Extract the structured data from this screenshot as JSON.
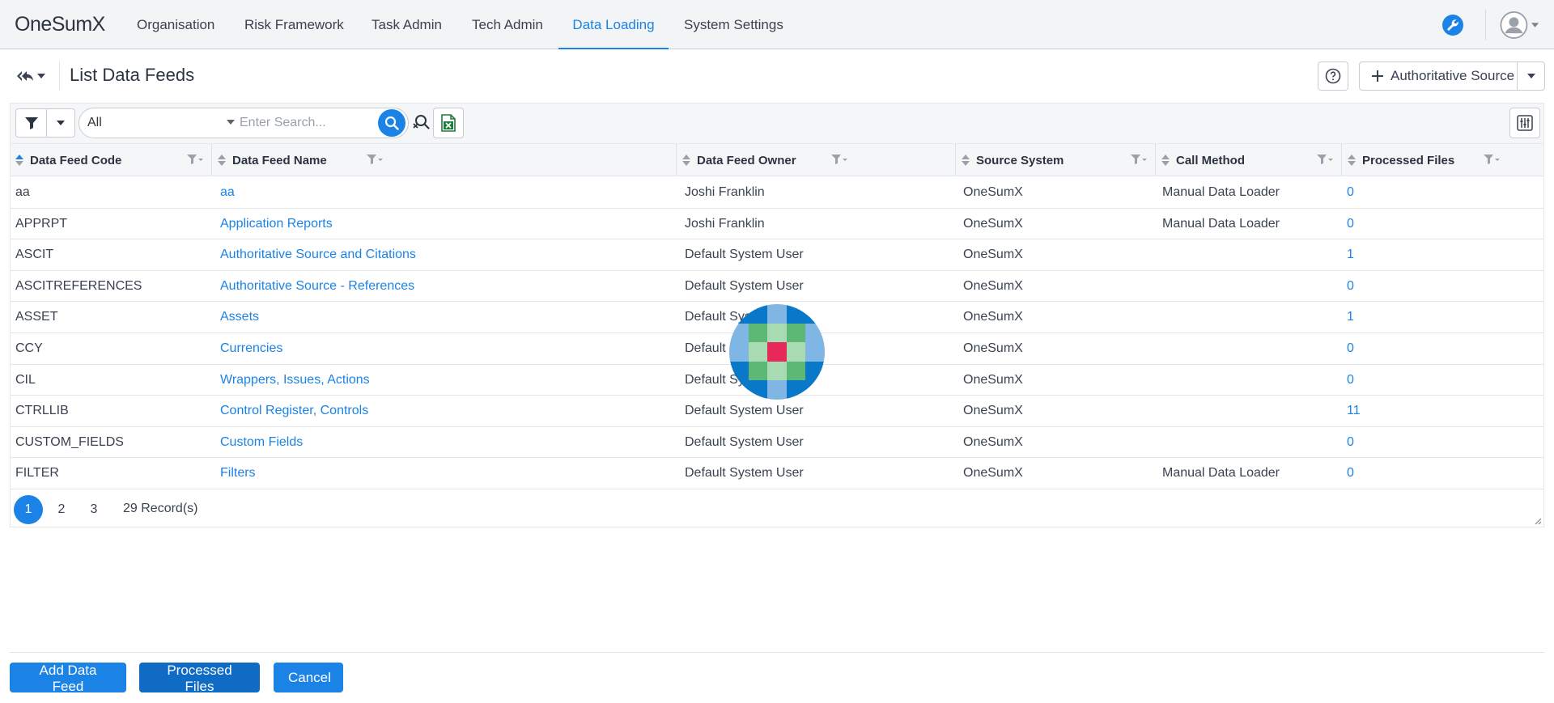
{
  "nav": {
    "brand": "OneSumX",
    "items": [
      {
        "label": "Organisation"
      },
      {
        "label": "Risk Framework"
      },
      {
        "label": "Task Admin"
      },
      {
        "label": "Tech Admin"
      },
      {
        "label": "Data Loading",
        "active": true
      },
      {
        "label": "System Settings"
      }
    ],
    "icons": [
      "wrench-icon",
      "user-avatar-icon"
    ]
  },
  "page": {
    "title": "List Data Feeds",
    "add_source_label": "Authoritative Source"
  },
  "toolbar": {
    "scope_value": "All",
    "search_placeholder": "Enter Search...",
    "search_value": ""
  },
  "grid": {
    "columns": [
      "Data Feed Code",
      "Data Feed Name",
      "Data Feed Owner",
      "Source System",
      "Call Method",
      "Processed Files"
    ],
    "sorted_column": "Data Feed Code",
    "rows": [
      {
        "code": "aa",
        "name": "aa",
        "owner": "Joshi Franklin",
        "source": "OneSumX",
        "method": "Manual Data Loader",
        "files": "0"
      },
      {
        "code": "APPRPT",
        "name": "Application Reports",
        "owner": "Joshi Franklin",
        "source": "OneSumX",
        "method": "Manual Data Loader",
        "files": "0"
      },
      {
        "code": "ASCIT",
        "name": "Authoritative Source and Citations",
        "owner": "Default System User",
        "source": "OneSumX",
        "method": "",
        "files": "1"
      },
      {
        "code": "ASCITREFERENCES",
        "name": "Authoritative Source - References",
        "owner": "Default System User",
        "source": "OneSumX",
        "method": "",
        "files": "0"
      },
      {
        "code": "ASSET",
        "name": "Assets",
        "owner": "Default System User",
        "source": "OneSumX",
        "method": "",
        "files": "1"
      },
      {
        "code": "CCY",
        "name": "Currencies",
        "owner": "Default System User",
        "source": "OneSumX",
        "method": "",
        "files": "0"
      },
      {
        "code": "CIL",
        "name": "Wrappers, Issues, Actions",
        "owner": "Default System User",
        "source": "OneSumX",
        "method": "",
        "files": "0"
      },
      {
        "code": "CTRLLIB",
        "name": "Control Register, Controls",
        "owner": "Default System User",
        "source": "OneSumX",
        "method": "",
        "files": "11"
      },
      {
        "code": "CUSTOM_FIELDS",
        "name": "Custom Fields",
        "owner": "Default System User",
        "source": "OneSumX",
        "method": "",
        "files": "0"
      },
      {
        "code": "FILTER",
        "name": "Filters",
        "owner": "Default System User",
        "source": "OneSumX",
        "method": "Manual Data Loader",
        "files": "0"
      }
    ],
    "pages": [
      "1",
      "2",
      "3"
    ],
    "current_page": "1",
    "records_label": "29 Record(s)"
  },
  "footer": {
    "add_label": "Add Data Feed",
    "processed_label": "Processed Files",
    "cancel_label": "Cancel"
  },
  "colors": {
    "accent": "#1b83e6",
    "loader_blue": "#0a78c8",
    "loader_light_blue": "#7fb6e3",
    "loader_green": "#5cb874",
    "loader_light_green": "#a8dbb2",
    "loader_red": "#e7295a"
  }
}
